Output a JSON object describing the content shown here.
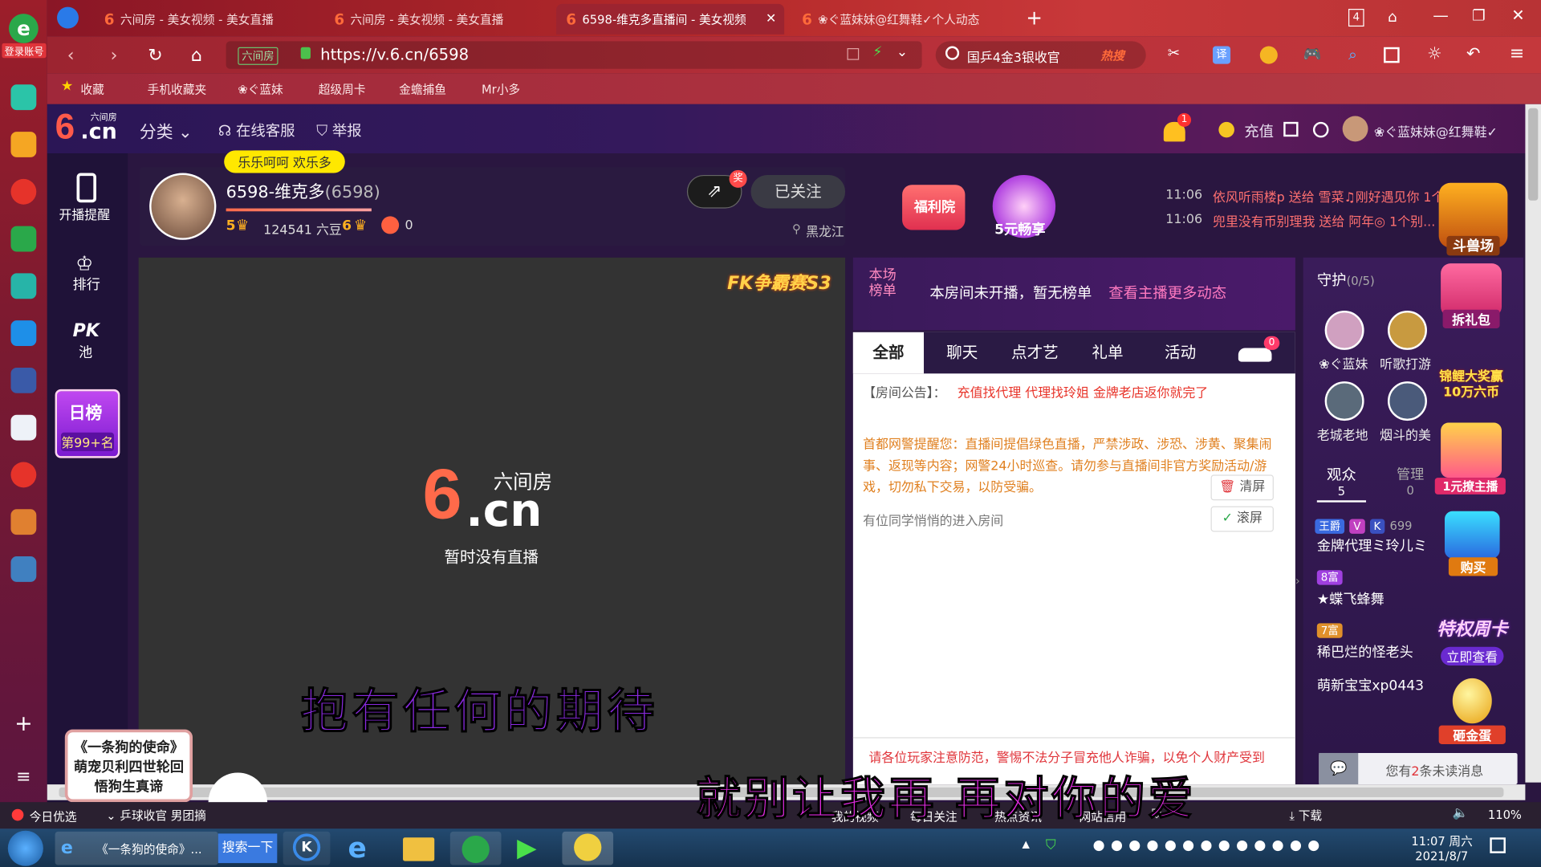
{
  "browser": {
    "tabs": [
      {
        "label": "六间房 - 美女视频 - 美女直播"
      },
      {
        "label": "六间房 - 美女视频 - 美女直播"
      },
      {
        "label": "6598-维克多直播间 - 美女视频"
      },
      {
        "label": "❀ぐ蓝妹妹@红舞鞋✓个人动态"
      }
    ],
    "tab_count": "4",
    "url": "https://v.6.cn/6598",
    "url_label": "六间房",
    "search_placeholder": "国乒4金3银收官",
    "search_hot": "热搜",
    "translate_label": "译",
    "bookmarks": [
      "收藏",
      "手机收藏夹",
      "❀ぐ蓝妹",
      "超级周卡",
      "金蟾捕鱼",
      "Mr小多"
    ],
    "login_label": "登录账号"
  },
  "site": {
    "logo_cn": "六间房",
    "logo_text": "6.cn",
    "nav_category": "分类",
    "nav_service": "在线客服",
    "nav_report": "举报",
    "notify_count": "1",
    "recharge": "充值",
    "username": "❀ぐ蓝妹妹@红舞鞋✓"
  },
  "tools": {
    "start_remind": "开播提醒",
    "rank": "排行",
    "pk": "PK",
    "pk_pool": "池",
    "daily_rank": "日榜",
    "daily_rank_pos": "第99+名"
  },
  "host": {
    "bubble": "乐乐呵呵 欢乐多",
    "name": "6598-维克多",
    "room_id": "(6598)",
    "level_a": "5",
    "beans": "124541 六豆",
    "level_b": "6",
    "fire": "0",
    "follow": "已关注",
    "share_badge": "奖",
    "location": "黑龙江",
    "welfare": "福利院",
    "five_yuan": "5元畅享"
  },
  "gifts_feed": [
    {
      "time": "11:06",
      "text": "依风听雨楼p 送给 雪菜♫刚好遇见你 1个"
    },
    {
      "time": "11:06",
      "text": "兜里没有币别理我 送给 阿年◎ 1个别..."
    }
  ],
  "promo": {
    "arena": "斗兽场",
    "pk_logo": "FK争霸赛S3",
    "unwrap_gift": "拆礼包",
    "koi": "锦鲤大奖赢10万六币",
    "one_yuan": "1元撩主播",
    "buy": "购买",
    "privilege": "特权周卡",
    "check_now": "立即查看",
    "golden_egg": "砸金蛋"
  },
  "video": {
    "logo_cn": "六间房",
    "logo_text": ".cn",
    "no_live": "暂时没有直播",
    "caption1": "抱有任何的期待",
    "caption2": "就别让我再 再对你的爱"
  },
  "board": {
    "label": "本场榜单",
    "empty_text": "本房间未开播，暂无榜单",
    "more_link": "查看主播更多动态"
  },
  "chat": {
    "tabs": [
      "全部",
      "聊天",
      "点才艺",
      "礼单",
      "活动"
    ],
    "car_count": "0",
    "notice_label": "【房间公告】：",
    "notice_text": "充值找代理 代理找玲姐 金牌老店返你就完了",
    "police_text": "首都网警提醒您：直播间提倡绿色直播，严禁涉政、涉恐、涉黄、聚集闹事、返现等内容；网警24小时巡查。请勿参与直播间非官方奖励活动/游戏，切勿私下交易，以防受骗。",
    "clear": "清屏",
    "scroll": "滚屏",
    "enter_msg": "有位同学悄悄的进入房间",
    "bottom_warning": "请各位玩家注意防范，警惕不法分子冒充他人诈骗，以免个人财产受到"
  },
  "guard": {
    "title": "守护",
    "count": "(0/5)",
    "members": [
      "❀ぐ蓝妹",
      "听歌打游",
      "老城老地",
      "烟斗的美"
    ]
  },
  "audience": {
    "tab_viewers": "观众",
    "viewers_count": "5",
    "tab_admin": "管理",
    "admin_count": "0",
    "list": [
      {
        "badge": "王爵",
        "extra": "699",
        "name": "金牌代理ミ玲儿ミ"
      },
      {
        "badge": "8富",
        "name": "★蝶飞蜂舞"
      },
      {
        "badge": "7富",
        "name": "稀巴烂的怪老头"
      },
      {
        "badge": "",
        "name": "萌新宝宝xp0443"
      }
    ]
  },
  "messages": {
    "text_pre": "您有",
    "count": "2",
    "text_post": "条未读消息"
  },
  "ad": {
    "text": "《一条狗的使命》萌宠贝利四世轮回悟狗生真谛"
  },
  "statusbar": {
    "hot_pick": "今日优选",
    "news": "乒球收官 男团摘",
    "my_video": "我的视频",
    "daily_follow": "每日关注",
    "hot_news": "热点资讯",
    "credit": "网站信用",
    "download": "下载",
    "zoom": "110%"
  },
  "taskbar": {
    "ie_item": "《一条狗的使命》...",
    "search_btn": "搜索一下",
    "time": "11:07 周六",
    "date": "2021/8/7"
  }
}
